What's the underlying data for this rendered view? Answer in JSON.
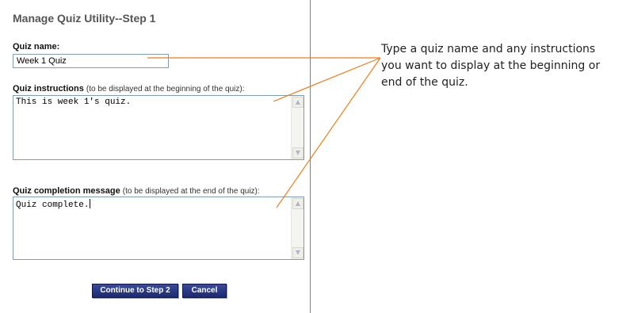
{
  "panel": {
    "title": "Manage Quiz Utility--Step 1"
  },
  "fields": {
    "name": {
      "label": "Quiz name:",
      "value": "Week 1 Quiz"
    },
    "instructions": {
      "label": "Quiz instructions",
      "hint": "(to be displayed at the beginning of the quiz):",
      "value": "This is week 1's quiz."
    },
    "completion": {
      "label": "Quiz completion message",
      "hint": "(to be displayed at the end of the quiz):",
      "value": "Quiz complete."
    }
  },
  "buttons": {
    "continue": "Continue to Step 2",
    "cancel": "Cancel"
  },
  "callout": {
    "lines": [
      "Type a quiz name and any instructions",
      "you want to display at the beginning or",
      "end of the quiz."
    ]
  },
  "colors": {
    "leader_line": "#f07d1a",
    "button_bg": "#1c2a6e",
    "title_text": "#555555"
  },
  "icons": {
    "scroll_up": "scroll-up-arrow-icon",
    "scroll_down": "scroll-down-arrow-icon"
  }
}
